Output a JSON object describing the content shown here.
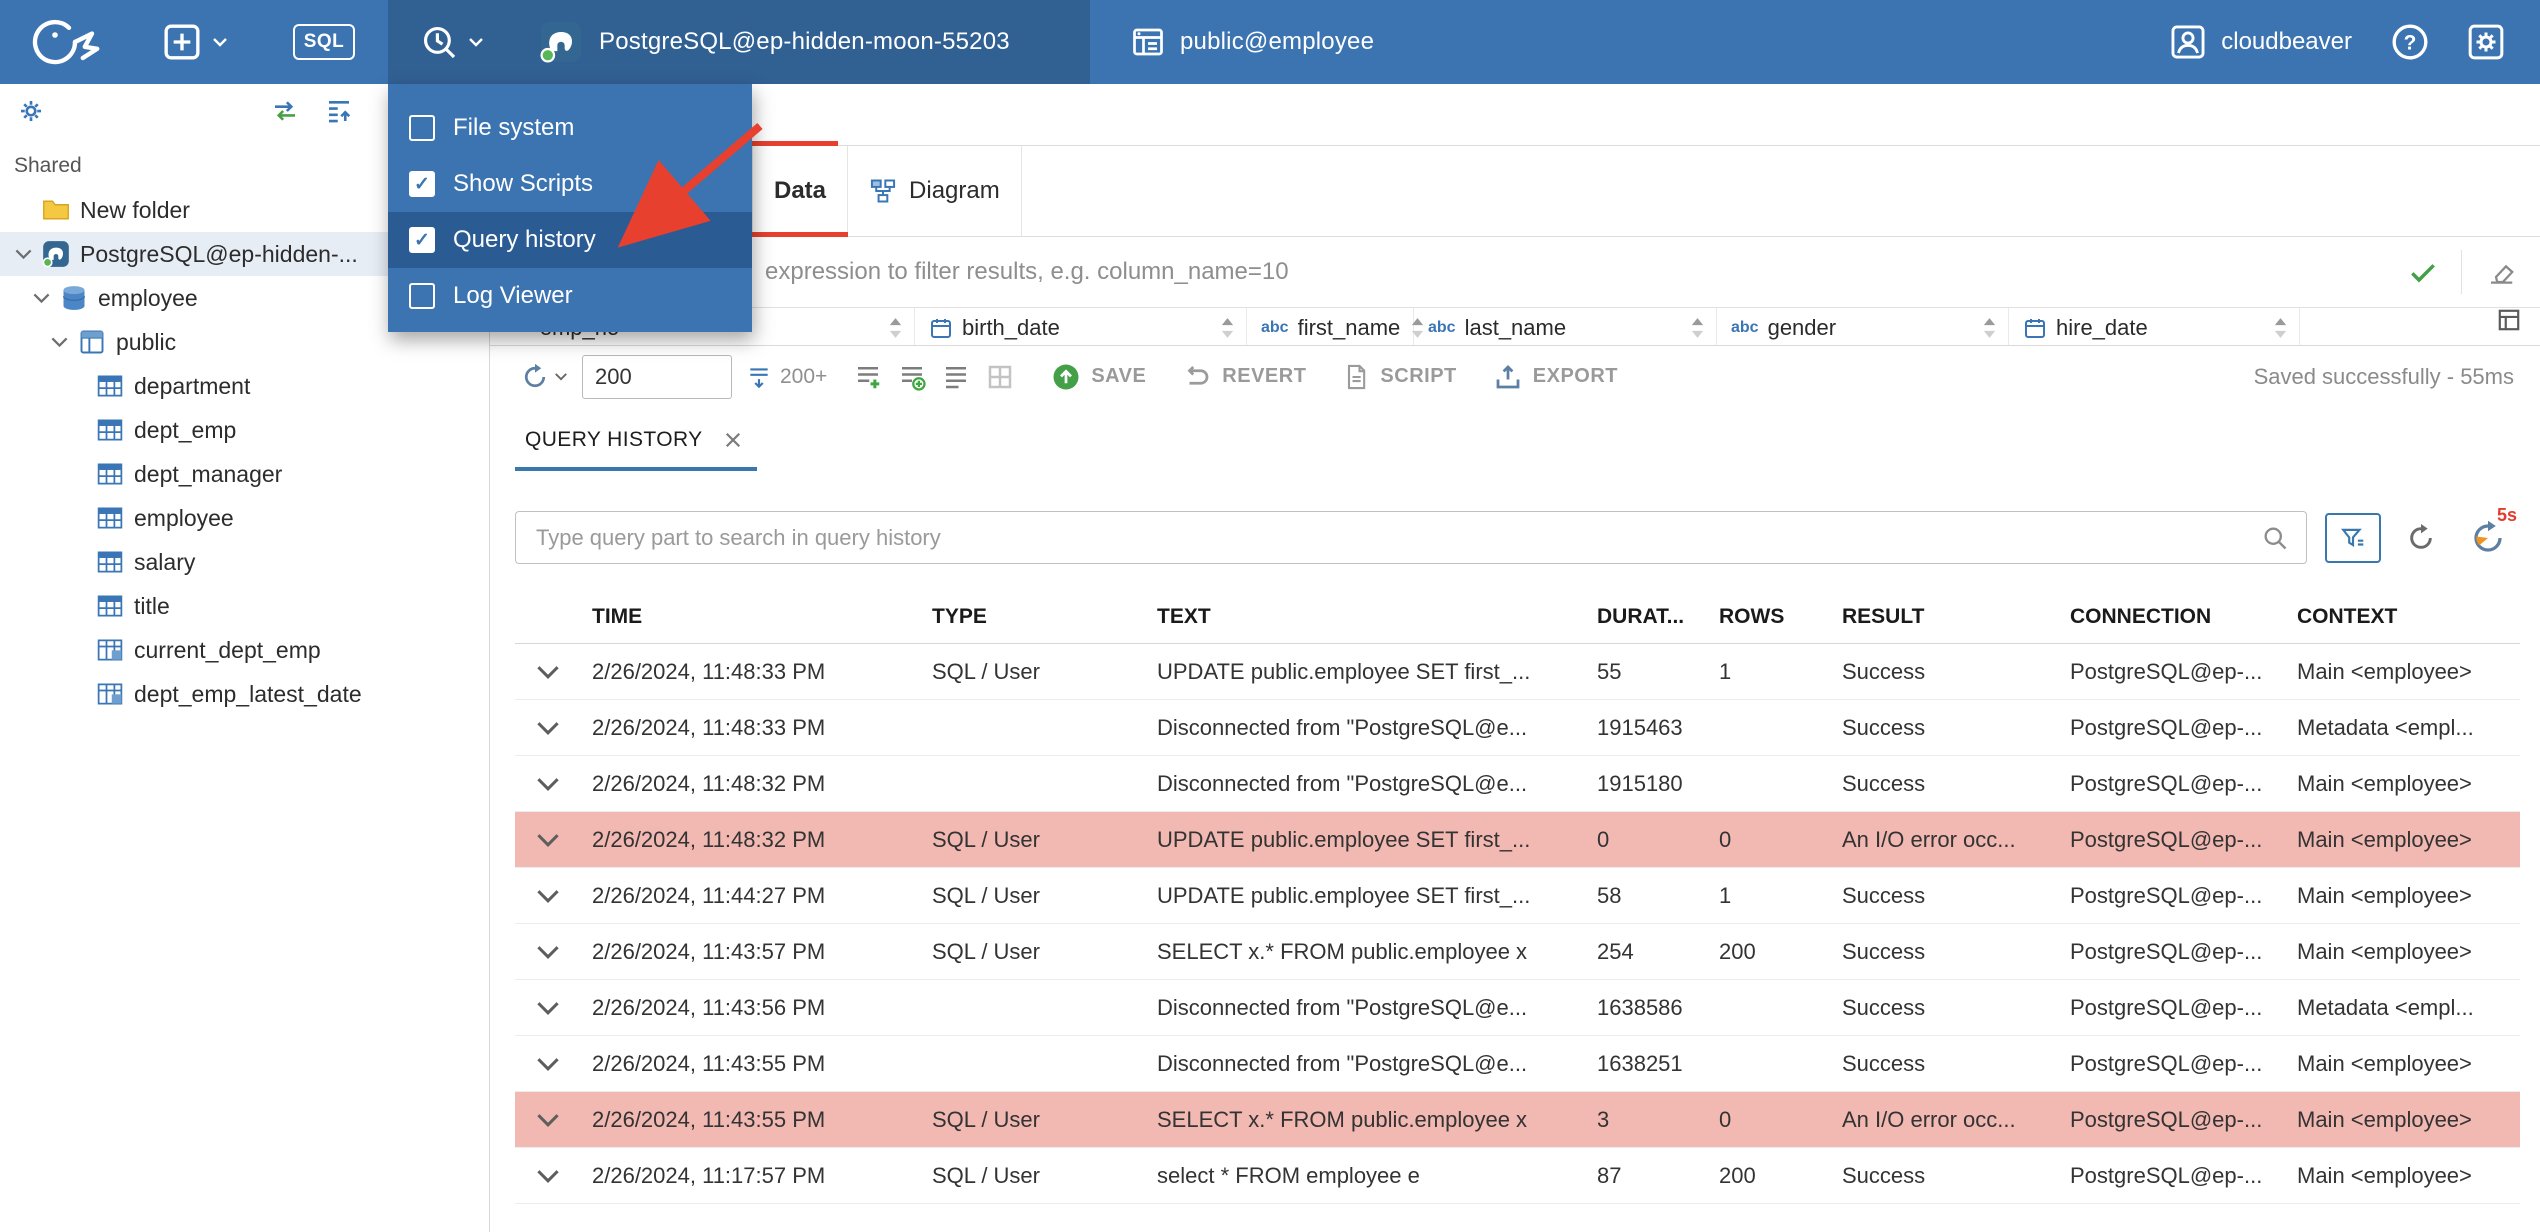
{
  "topbar": {
    "sql_label": "SQL",
    "connection_label": "PostgreSQL@ep-hidden-moon-55203",
    "schema_label": "public@employee",
    "user_label": "cloudbeaver"
  },
  "tools_menu": {
    "items": [
      {
        "label": "File system",
        "checked": false,
        "highlighted": false
      },
      {
        "label": "Show Scripts",
        "checked": true,
        "highlighted": false
      },
      {
        "label": "Query history",
        "checked": true,
        "highlighted": true
      },
      {
        "label": "Log Viewer",
        "checked": false,
        "highlighted": false
      }
    ]
  },
  "sidebar": {
    "section_label": "Shared",
    "tree": [
      {
        "label": "New folder",
        "icon": "folder",
        "indent": 0,
        "chevron": null,
        "selected": false
      },
      {
        "label": "PostgreSQL@ep-hidden-...",
        "icon": "postgres",
        "indent": 0,
        "chevron": "expanded",
        "selected": true
      },
      {
        "label": "employee",
        "icon": "database",
        "indent": 1,
        "chevron": "expanded",
        "selected": false
      },
      {
        "label": "public",
        "icon": "schema",
        "indent": 2,
        "chevron": "expanded",
        "selected": false
      },
      {
        "label": "department",
        "icon": "table",
        "indent": 3,
        "chevron": null,
        "selected": false
      },
      {
        "label": "dept_emp",
        "icon": "table",
        "indent": 3,
        "chevron": null,
        "selected": false
      },
      {
        "label": "dept_manager",
        "icon": "table",
        "indent": 3,
        "chevron": null,
        "selected": false
      },
      {
        "label": "employee",
        "icon": "table",
        "indent": 3,
        "chevron": null,
        "selected": false
      },
      {
        "label": "salary",
        "icon": "table",
        "indent": 3,
        "chevron": null,
        "selected": false
      },
      {
        "label": "title",
        "icon": "table",
        "indent": 3,
        "chevron": null,
        "selected": false
      },
      {
        "label": "current_dept_emp",
        "icon": "view",
        "indent": 3,
        "chevron": null,
        "selected": false
      },
      {
        "label": "dept_emp_latest_date",
        "icon": "view",
        "indent": 3,
        "chevron": null,
        "selected": false
      }
    ]
  },
  "object_page": {
    "tabs": [
      {
        "label": "Data",
        "active": true
      },
      {
        "label": "Diagram",
        "active": false
      }
    ],
    "filter_placeholder": "expression to filter results, e.g. column_name=10",
    "grid_columns": [
      {
        "name": "emp_no",
        "type": "number"
      },
      {
        "name": "birth_date",
        "type": "date"
      },
      {
        "name": "first_name",
        "type": "string"
      },
      {
        "name": "last_name",
        "type": "string"
      },
      {
        "name": "gender",
        "type": "string"
      },
      {
        "name": "hire_date",
        "type": "date"
      }
    ],
    "toolbar": {
      "fetch_size_value": "200",
      "fetch_more_label": "200+",
      "save_label": "SAVE",
      "revert_label": "REVERT",
      "script_label": "SCRIPT",
      "export_label": "EXPORT",
      "status_text": "Saved successfully - 55ms"
    }
  },
  "query_history": {
    "tab_label": "QUERY HISTORY",
    "search_placeholder": "Type query part to search in query history",
    "auto_refresh_badge": "5s",
    "columns": [
      "TIME",
      "TYPE",
      "TEXT",
      "DURAT...",
      "ROWS",
      "RESULT",
      "CONNECTION",
      "CONTEXT"
    ],
    "rows": [
      {
        "time": "2/26/2024, 11:48:33 PM",
        "type": "SQL / User",
        "text": "UPDATE public.employee SET first_...",
        "duration": "55",
        "rows": "1",
        "result": "Success",
        "connection": "PostgreSQL@ep-...",
        "context": "Main <employee>",
        "error": false
      },
      {
        "time": "2/26/2024, 11:48:33 PM",
        "type": "",
        "text": "Disconnected from \"PostgreSQL@e...",
        "duration": "1915463",
        "rows": "",
        "result": "Success",
        "connection": "PostgreSQL@ep-...",
        "context": "Metadata <empl...",
        "error": false
      },
      {
        "time": "2/26/2024, 11:48:32 PM",
        "type": "",
        "text": "Disconnected from \"PostgreSQL@e...",
        "duration": "1915180",
        "rows": "",
        "result": "Success",
        "connection": "PostgreSQL@ep-...",
        "context": "Main <employee>",
        "error": false
      },
      {
        "time": "2/26/2024, 11:48:32 PM",
        "type": "SQL / User",
        "text": "UPDATE public.employee SET first_...",
        "duration": "0",
        "rows": "0",
        "result": "An I/O error occ...",
        "connection": "PostgreSQL@ep-...",
        "context": "Main <employee>",
        "error": true
      },
      {
        "time": "2/26/2024, 11:44:27 PM",
        "type": "SQL / User",
        "text": "UPDATE public.employee SET first_...",
        "duration": "58",
        "rows": "1",
        "result": "Success",
        "connection": "PostgreSQL@ep-...",
        "context": "Main <employee>",
        "error": false
      },
      {
        "time": "2/26/2024, 11:43:57 PM",
        "type": "SQL / User",
        "text": "SELECT x.* FROM public.employee x",
        "duration": "254",
        "rows": "200",
        "result": "Success",
        "connection": "PostgreSQL@ep-...",
        "context": "Main <employee>",
        "error": false
      },
      {
        "time": "2/26/2024, 11:43:56 PM",
        "type": "",
        "text": "Disconnected from \"PostgreSQL@e...",
        "duration": "1638586",
        "rows": "",
        "result": "Success",
        "connection": "PostgreSQL@ep-...",
        "context": "Metadata <empl...",
        "error": false
      },
      {
        "time": "2/26/2024, 11:43:55 PM",
        "type": "",
        "text": "Disconnected from \"PostgreSQL@e...",
        "duration": "1638251",
        "rows": "",
        "result": "Success",
        "connection": "PostgreSQL@ep-...",
        "context": "Main <employee>",
        "error": false
      },
      {
        "time": "2/26/2024, 11:43:55 PM",
        "type": "SQL / User",
        "text": "SELECT x.* FROM public.employee x",
        "duration": "3",
        "rows": "0",
        "result": "An I/O error occ...",
        "connection": "PostgreSQL@ep-...",
        "context": "Main <employee>",
        "error": true
      },
      {
        "time": "2/26/2024, 11:17:57 PM",
        "type": "SQL / User",
        "text": "select * FROM employee e",
        "duration": "87",
        "rows": "200",
        "result": "Success",
        "connection": "PostgreSQL@ep-...",
        "context": "Main <employee>",
        "error": false
      }
    ]
  }
}
